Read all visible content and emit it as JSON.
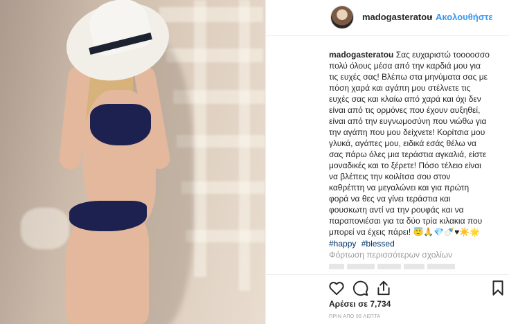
{
  "header": {
    "username": "madogasteratou",
    "separator": "•",
    "follow_label": "Ακολουθήστε"
  },
  "caption": {
    "username": "madogasteratou",
    "text": " Σας ευχαριστώ τοοοοσσο\nπολύ όλους μέσα από την καρδιά μου για\nτις ευχές σας! Βλέπω στα μηνύματα σας με\nπόση χαρά και αγάπη μου στέλνετε τις\nευχές σας και κλαίω από χαρά και όχι δεν\nείναι από τις ορμόνες που έχουν αυξηθεί,\nείναι από την ευγνωμοσύνη που νιώθω για\nτην αγάπη που μου δείχνετε! Κορίτσια μου\nγλυκά, αγάπες μου, ειδικά εσάς θέλω να\nσας πάρω όλες μια τεράστια αγκαλιά, είστε\nμοναδικές και το ξέρετε! Πόσο τέλειο είναι\nνα βλέπεις την κοιλίτσα σου στον\nκαθρέπτη να μεγαλώνει και για πρώτη\nφορά να θες να γίνει τεράστια και\nφουσκωτη αντί να την ρουφάς και να\nπαραπονιέσαι για τα δύο τρία κιλακια που\nμπορεί να έχεις πάρει! 😇🙏💎🍼♥☀️🌟",
    "hashtags": [
      "#happy",
      "#blessed"
    ]
  },
  "load_more_label": "Φόρτωση περισσότερων σχολίων",
  "actions": {
    "like_icon": "heart-outline-icon",
    "comment_icon": "speech-bubble-icon",
    "share_icon": "share-arrow-icon",
    "save_icon": "bookmark-icon"
  },
  "likes_label": "Αρέσει σε 7,734",
  "timestamp": "ΠΡΙΝ ΑΠΟ 55 ΛΕΠΤΑ",
  "colors": {
    "link_blue": "#3897f0",
    "hashtag": "#003569",
    "muted": "#999999",
    "text": "#262626"
  }
}
